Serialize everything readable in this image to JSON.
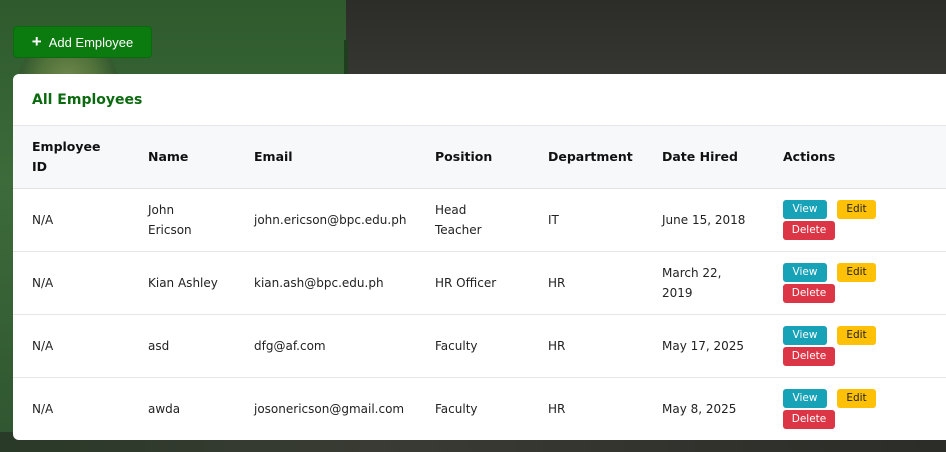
{
  "toolbar": {
    "add_label": "Add Employee",
    "add_icon": "plus-icon"
  },
  "card": {
    "title": "All Employees"
  },
  "table": {
    "headers": [
      "Employee ID",
      "Name",
      "Email",
      "Position",
      "Department",
      "Date Hired",
      "Actions"
    ],
    "header_lines": {
      "employee_id": [
        "Employee",
        "ID"
      ]
    },
    "rows": [
      {
        "id": "N/A",
        "name": [
          "John",
          "Ericson"
        ],
        "email": "john.ericson@bpc.edu.ph",
        "position": [
          "Head",
          "Teacher"
        ],
        "department": "IT",
        "date_hired": [
          "June 15, 2018"
        ]
      },
      {
        "id": "N/A",
        "name": [
          "Kian Ashley"
        ],
        "email": "kian.ash@bpc.edu.ph",
        "position": [
          "HR Officer"
        ],
        "department": "HR",
        "date_hired": [
          "March 22,",
          "2019"
        ]
      },
      {
        "id": "N/A",
        "name": [
          "asd"
        ],
        "email": "dfg@af.com",
        "position": [
          "Faculty"
        ],
        "department": "HR",
        "date_hired": [
          "May 17, 2025"
        ]
      },
      {
        "id": "N/A",
        "name": [
          "awda"
        ],
        "email": "josonericson@gmail.com",
        "position": [
          "Faculty"
        ],
        "department": "HR",
        "date_hired": [
          "May 8, 2025"
        ]
      }
    ],
    "actions": {
      "view": "View",
      "edit": "Edit",
      "delete": "Delete"
    }
  },
  "colors": {
    "primary_green": "#0b7a0f",
    "title_green": "#0b6a0f",
    "view": "#17a2b8",
    "edit": "#ffc107",
    "delete": "#dc3545"
  }
}
